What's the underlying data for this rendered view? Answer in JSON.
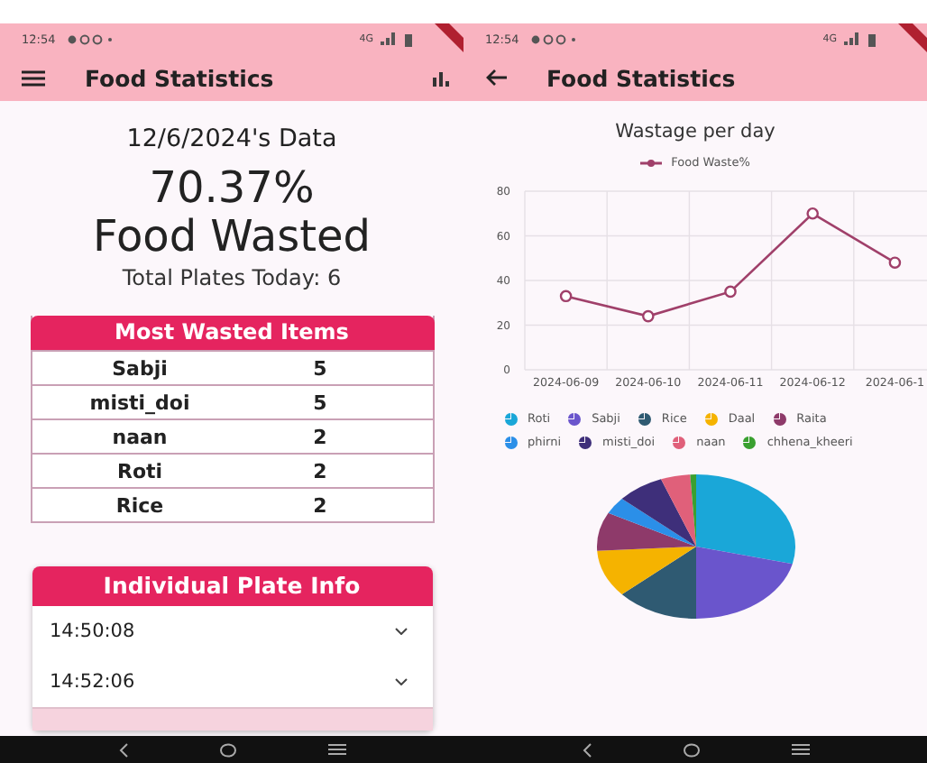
{
  "screens": [
    {
      "kind": "summary",
      "status_bar": {
        "time": "12:54",
        "network": "4G"
      },
      "app_bar": {
        "title": "Food Statistics",
        "back_button": false
      },
      "date_title": "12/6/2024's Data",
      "percent": "70.37%",
      "percent_label": "Food Wasted",
      "total_plates": "Total Plates Today: 6",
      "most_wasted": {
        "title": "Most Wasted Items",
        "rows": [
          {
            "item": "Sabji",
            "count": "5"
          },
          {
            "item": "misti_doi",
            "count": "5"
          },
          {
            "item": "naan",
            "count": "2"
          },
          {
            "item": "Roti",
            "count": "2"
          },
          {
            "item": "Rice",
            "count": "2"
          }
        ]
      },
      "plate_info": {
        "title": "Individual Plate Info",
        "rows": [
          {
            "time": "14:50:08",
            "expanded": false
          },
          {
            "time": "14:52:06",
            "expanded": false
          }
        ]
      }
    },
    {
      "kind": "charts",
      "status_bar": {
        "time": "12:54",
        "network": "4G"
      },
      "app_bar": {
        "title": "Food Statistics",
        "back_button": true
      },
      "chart_data": {
        "type": "line",
        "title": "Wastage per day",
        "categories": [
          "2024-06-09",
          "2024-06-10",
          "2024-06-11",
          "2024-06-12",
          "2024-06-1"
        ],
        "series": [
          {
            "name": "Food Waste%",
            "color": "#a0406a",
            "marker": "circle",
            "values": [
              33,
              24,
              35,
              70,
              48
            ]
          }
        ],
        "grid": true,
        "ylim": [
          0,
          80
        ],
        "yticks": [
          0,
          20,
          40,
          60,
          80
        ]
      },
      "pie_legend": [
        {
          "label": "Roti",
          "color": "#1aa7d8"
        },
        {
          "label": "Sabji",
          "color": "#6a55cc"
        },
        {
          "label": "Rice",
          "color": "#2f5a72"
        },
        {
          "label": "Daal",
          "color": "#f5b300"
        },
        {
          "label": "Raita",
          "color": "#8e3a6a"
        },
        {
          "label": "phirni",
          "color": "#2b8fe8"
        },
        {
          "label": "misti_doi",
          "color": "#3e2f7a"
        },
        {
          "label": "naan",
          "color": "#e0607a"
        },
        {
          "label": "chhena_kheeri",
          "color": "#3aa030"
        }
      ]
    }
  ]
}
